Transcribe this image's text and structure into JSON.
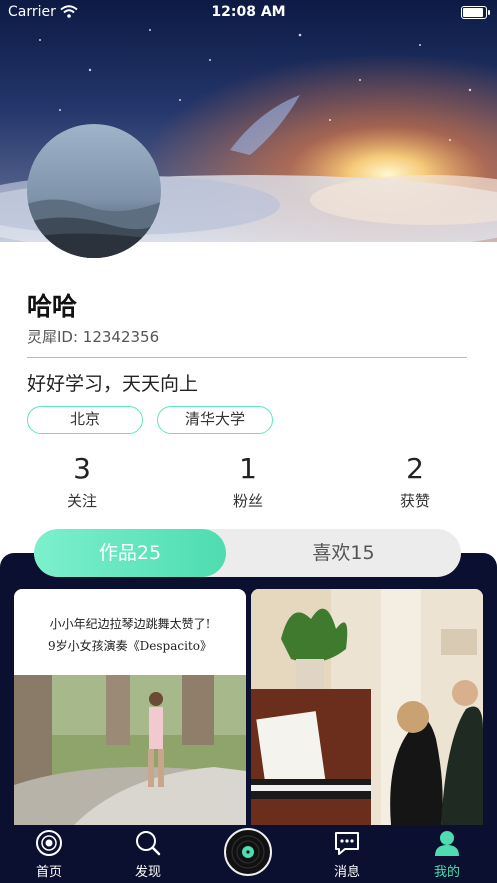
{
  "status_bar": {
    "carrier": "Carrier",
    "time": "12:08 AM"
  },
  "profile": {
    "name": "哈哈",
    "id_text": "灵犀ID: 12342356",
    "bio": "好好学习，天天向上",
    "tags": [
      "北京",
      "清华大学"
    ]
  },
  "stats": [
    {
      "value": "3",
      "label": "关注"
    },
    {
      "value": "1",
      "label": "粉丝"
    },
    {
      "value": "2",
      "label": "获赞"
    }
  ],
  "tabs": {
    "works": "作品25",
    "likes": "喜欢15",
    "selected": "works"
  },
  "cards": [
    {
      "caption_line1": "小小年纪边拉琴边跳舞太赞了!",
      "caption_line2": "9岁小女孩演奏《Despacito》"
    },
    {}
  ],
  "tabbar": [
    {
      "label": "首页",
      "icon": "home-record-icon"
    },
    {
      "label": "发现",
      "icon": "search-icon"
    },
    {
      "label": "",
      "icon": "vinyl-disc-icon"
    },
    {
      "label": "消息",
      "icon": "message-icon"
    },
    {
      "label": "我的",
      "icon": "profile-icon"
    }
  ],
  "colors": {
    "accent": "#4fdcb0",
    "dark_panel": "#0b1030"
  }
}
